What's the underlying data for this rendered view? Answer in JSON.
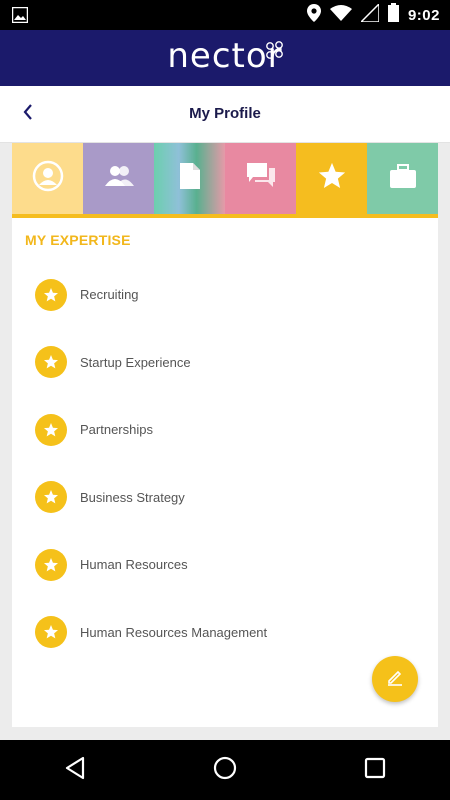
{
  "status_bar": {
    "time": "9:02",
    "icons": [
      "image-icon",
      "location-icon",
      "wifi-icon",
      "signal-icon",
      "battery-icon"
    ]
  },
  "app_header": {
    "brand": "nector",
    "brand_color": "#1b1a6b"
  },
  "title_bar": {
    "title": "My Profile",
    "back_icon": "chevron-left-icon"
  },
  "profile_tabs": [
    {
      "name": "profile",
      "icon": "person-icon",
      "color": "#fddc8c",
      "active": false
    },
    {
      "name": "connections",
      "icon": "people-icon",
      "color": "#a99ac8",
      "active": false
    },
    {
      "name": "documents",
      "icon": "document-icon",
      "color": "#6ccfae",
      "active": false
    },
    {
      "name": "messages",
      "icon": "chat-icon",
      "color": "#e889a1",
      "active": false
    },
    {
      "name": "expertise",
      "icon": "star-icon",
      "color": "#f5bd1f",
      "active": true
    },
    {
      "name": "work",
      "icon": "briefcase-icon",
      "color": "#7fcaa8",
      "active": false
    }
  ],
  "expertise": {
    "heading": "MY EXPERTISE",
    "accent_color": "#f2b71c",
    "items": [
      {
        "label": "Recruiting"
      },
      {
        "label": "Startup Experience"
      },
      {
        "label": "Partnerships"
      },
      {
        "label": "Business Strategy"
      },
      {
        "label": "Human Resources"
      },
      {
        "label": "Human Resources Management"
      }
    ]
  },
  "fab": {
    "icon": "pencil-icon"
  },
  "nav_bar": {
    "buttons": [
      "back-triangle-icon",
      "home-circle-icon",
      "recents-square-icon"
    ]
  }
}
